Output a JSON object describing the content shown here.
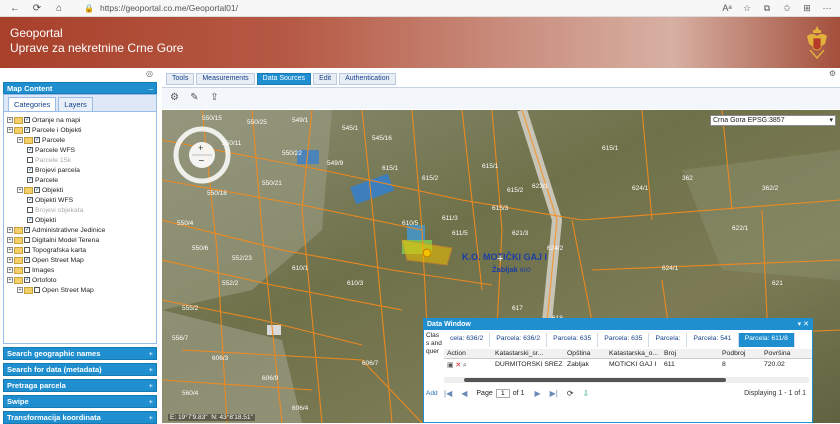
{
  "browser": {
    "url": "https://geoportal.co.me/Geoportal01/",
    "back_icon": "back-arrow-icon",
    "refresh_icon": "refresh-icon",
    "home_icon": "home-icon",
    "lock_icon": "lock-icon"
  },
  "banner": {
    "title": "Geoportal",
    "subtitle": "Uprave za nekretnine Crne Gore"
  },
  "left_panel": {
    "header": "Map Content",
    "tabs": [
      "Categories",
      "Layers"
    ],
    "tree": [
      {
        "label": "Ortanje na mapi",
        "level": 0,
        "checked": true
      },
      {
        "label": "Parcele i Objekti",
        "level": 0,
        "checked": true
      },
      {
        "label": "Parcele",
        "level": 1,
        "checked": true
      },
      {
        "label": "Parcele WFS",
        "level": 2,
        "checked": true
      },
      {
        "label": "Parcele 15k",
        "level": 2,
        "checked": false
      },
      {
        "label": "Brojevi parcela",
        "level": 2,
        "checked": true
      },
      {
        "label": "Parcele",
        "level": 2,
        "checked": true
      },
      {
        "label": "Objekti",
        "level": 1,
        "checked": true
      },
      {
        "label": "Objekti WFS",
        "level": 2,
        "checked": true
      },
      {
        "label": "Brojevi objekata",
        "level": 2,
        "checked": false
      },
      {
        "label": "Objekti",
        "level": 2,
        "checked": true
      },
      {
        "label": "Administrativne Jedinice",
        "level": 0,
        "checked": true
      },
      {
        "label": "Digitalni Model Terena",
        "level": 0,
        "checked": false
      },
      {
        "label": "Topografska karta",
        "level": 0,
        "checked": false
      },
      {
        "label": "Open Street Map",
        "level": 0,
        "checked": true
      },
      {
        "label": "Images",
        "level": 0,
        "checked": false
      },
      {
        "label": "Ortofoto",
        "level": 0,
        "checked": true
      },
      {
        "label": "Open Street Map",
        "level": 1,
        "checked": false
      }
    ],
    "accordions": [
      "Search geographic names",
      "Search for data (metadata)",
      "Pretraga parcela",
      "Swipe",
      "Transformacija koordinata"
    ]
  },
  "main": {
    "tabs": [
      "Tools",
      "Measurements",
      "Data Sources",
      "Edit",
      "Authentication"
    ],
    "active_tab": "Data Sources",
    "crs": "Crna Gora EPSG:3857",
    "coords_e": "E: 19°7'9.83\"",
    "coords_n": "N: 43°8'18.51\"",
    "map_labels": {
      "ko": "K.O. MOTIČKI GAJ I",
      "town": "Žabljak",
      "town_num": "600"
    }
  },
  "data_window": {
    "title": "Data Window",
    "side_label": "Class and quer",
    "add_label": "Add",
    "tabs": [
      "cela: 636/2",
      "Parcela: 636/2",
      "Parcela: 635",
      "Parcela: 635",
      "Parcela:",
      "Parcela: 541",
      "Parcela: 611/8"
    ],
    "columns": [
      "Action",
      "Katastarski_sr...",
      "Opština",
      "Katastarska_o...",
      "Broj",
      "Podbroj",
      "Površina"
    ],
    "row": {
      "katastarski": "DURMITORSKI SREZ",
      "opstina": "Žabljak",
      "katastarska_opstina": "MOTIČKI GAJ I",
      "broj": "611",
      "podbroj": "8",
      "povrsina": "720.02"
    },
    "page_label": "Page",
    "page_value": "1",
    "of_label": "of 1",
    "displaying": "Displaying 1 - 1 of 1"
  }
}
